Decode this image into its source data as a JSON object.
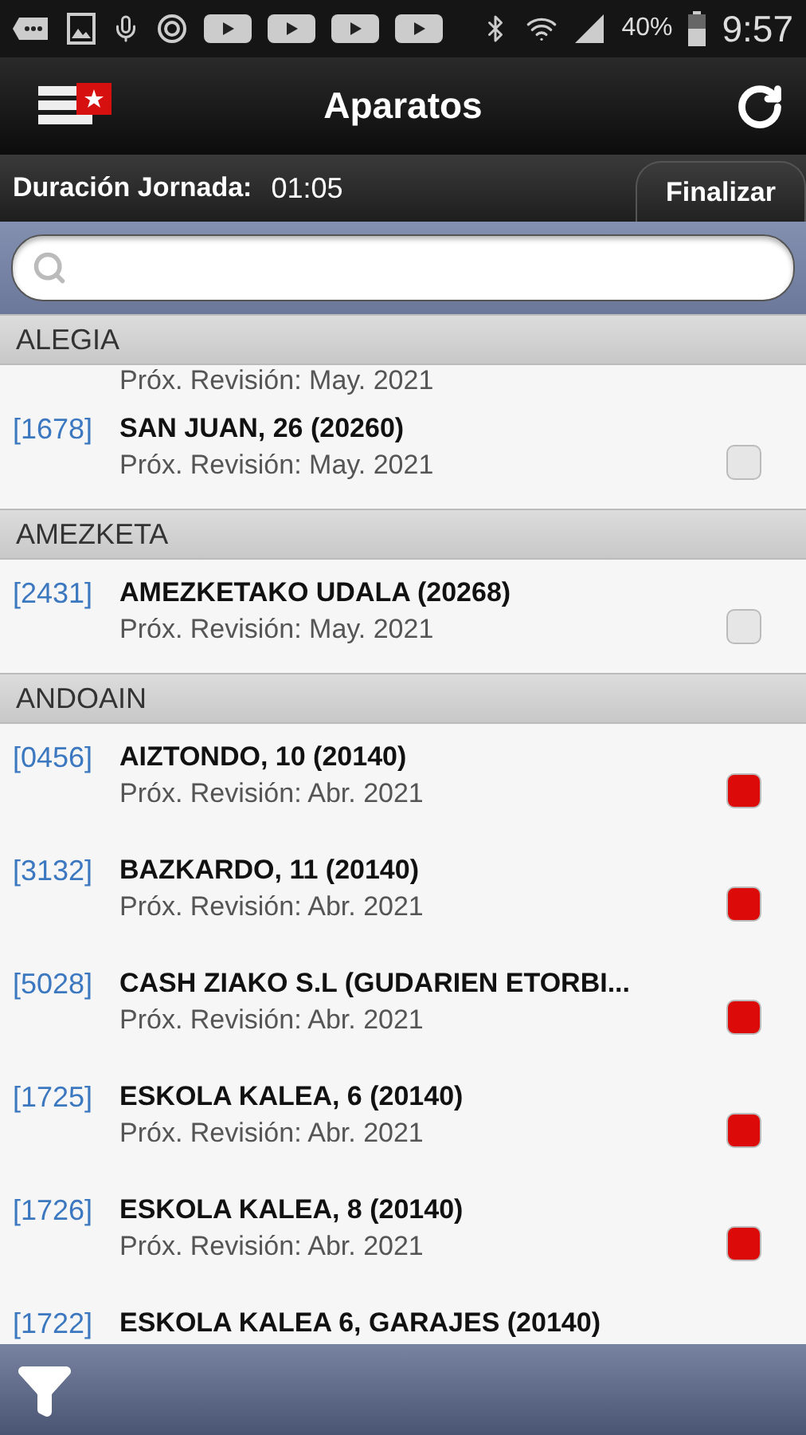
{
  "status_bar": {
    "battery": "40%",
    "time": "9:57"
  },
  "header": {
    "title": "Aparatos"
  },
  "shift_bar": {
    "label": "Duración Jornada:",
    "value": "01:05",
    "button": "Finalizar"
  },
  "sections": [
    {
      "name": "ALEGIA",
      "rows": [
        {
          "subtitle": "Próx. Revisión: May. 2021"
        },
        {
          "code": "[1678]",
          "title": "SAN JUAN, 26 (20260)",
          "subtitle": "Próx. Revisión: May. 2021",
          "color": "#e6e6e6"
        }
      ]
    },
    {
      "name": "AMEZKETA",
      "rows": [
        {
          "code": "[2431]",
          "title": "AMEZKETAKO UDALA (20268)",
          "subtitle": "Próx. Revisión: May. 2021",
          "color": "#e6e6e6"
        }
      ]
    },
    {
      "name": "ANDOAIN",
      "rows": [
        {
          "code": "[0456]",
          "title": "AIZTONDO, 10 (20140)",
          "subtitle": "Próx. Revisión: Abr. 2021",
          "color": "#dd0a0a"
        },
        {
          "code": "[3132]",
          "title": "BAZKARDO, 11 (20140)",
          "subtitle": "Próx. Revisión: Abr. 2021",
          "color": "#dd0a0a"
        },
        {
          "code": "[5028]",
          "title": "CASH ZIAKO S.L (GUDARIEN ETORBI...",
          "subtitle": "Próx. Revisión: Abr. 2021",
          "color": "#dd0a0a"
        },
        {
          "code": "[1725]",
          "title": "ESKOLA KALEA, 6 (20140)",
          "subtitle": "Próx. Revisión: Abr. 2021",
          "color": "#dd0a0a"
        },
        {
          "code": "[1726]",
          "title": "ESKOLA KALEA, 8 (20140)",
          "subtitle": "Próx. Revisión: Abr. 2021",
          "color": "#dd0a0a"
        },
        {
          "code": "[1722]",
          "title": "ESKOLA KALEA 6, GARAJES (20140)"
        }
      ]
    }
  ]
}
